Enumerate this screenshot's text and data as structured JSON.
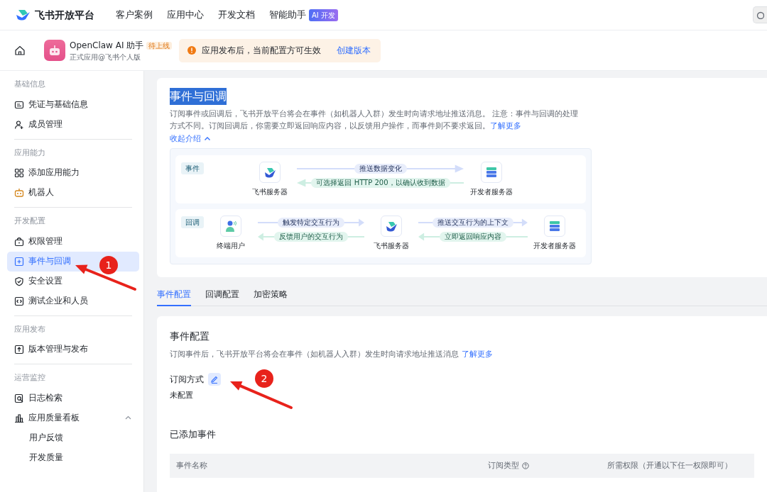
{
  "top_nav": {
    "brand": "飞书开放平台",
    "links": [
      {
        "label": "客户案例"
      },
      {
        "label": "应用中心"
      },
      {
        "label": "开发文档"
      },
      {
        "label": "智能助手",
        "badge": "AI 开发"
      }
    ]
  },
  "app_header": {
    "app_name": "OpenClaw AI 助手",
    "status_tag": "待上线",
    "subtitle": "正式应用@飞书个人版",
    "notice": "应用发布后，当前配置方可生效",
    "notice_action": "创建版本"
  },
  "sidebar": {
    "groups": [
      {
        "title": "基础信息",
        "items": [
          {
            "label": "凭证与基础信息",
            "selected": false
          },
          {
            "label": "成员管理",
            "selected": false
          }
        ]
      },
      {
        "title": "应用能力",
        "items": [
          {
            "label": "添加应用能力",
            "selected": false
          },
          {
            "label": "机器人",
            "selected": false
          }
        ]
      },
      {
        "title": "开发配置",
        "items": [
          {
            "label": "权限管理",
            "selected": false
          },
          {
            "label": "事件与回调",
            "selected": true
          },
          {
            "label": "安全设置",
            "selected": false
          },
          {
            "label": "测试企业和人员",
            "selected": false
          }
        ]
      },
      {
        "title": "应用发布",
        "items": [
          {
            "label": "版本管理与发布",
            "selected": false
          }
        ]
      },
      {
        "title": "运营监控",
        "items": [
          {
            "label": "日志检索",
            "selected": false
          },
          {
            "label": "应用质量看板",
            "selected": false,
            "expanded": true,
            "children": [
              {
                "label": "用户反馈",
                "selected": false
              },
              {
                "label": "开发质量",
                "selected": false
              }
            ]
          }
        ]
      }
    ]
  },
  "intro": {
    "title": "事件与回调",
    "highlighted": true,
    "description": "订阅事件或回调后，飞书开放平台将会在事件（如机器人入群）发生时向请求地址推送消息。 注意：事件与回调的处理方式不同。订阅回调后，你需要立即返回响应内容，以反馈用户操作，而事件则不要求返回。",
    "link": "了解更多",
    "toggle": "收起介绍",
    "expanded": true
  },
  "diagram": {
    "rows": [
      {
        "tag": "事件",
        "nodes": [
          {
            "kind": "platform",
            "label": "飞书服务器"
          },
          {
            "kind": "server",
            "label": "开发者服务器"
          }
        ],
        "links": [
          {
            "forward": "推送数据变化",
            "back": "可选择返回 HTTP 200，以确认收到数据"
          }
        ]
      },
      {
        "tag": "回调",
        "nodes": [
          {
            "kind": "user",
            "label": "终端用户"
          },
          {
            "kind": "platform",
            "label": "飞书服务器"
          },
          {
            "kind": "server",
            "label": "开发者服务器"
          }
        ],
        "links": [
          {
            "forward": "触发特定交互行为",
            "back": "反馈用户的交互行为"
          },
          {
            "forward": "推送交互行为的上下文",
            "back": "立即返回响应内容"
          }
        ]
      }
    ]
  },
  "tabs": [
    {
      "label": "事件配置",
      "selected": true
    },
    {
      "label": "回调配置",
      "selected": false
    },
    {
      "label": "加密策略",
      "selected": false
    }
  ],
  "event_config": {
    "title": "事件配置",
    "description": "订阅事件后，飞书开放平台将会在事件（如机器人入群）发生时向请求地址推送消息",
    "link": "了解更多",
    "subscription_label": "订阅方式",
    "subscription_value": "未配置",
    "added_title": "已添加事件",
    "table": {
      "columns": [
        {
          "label": "事件名称",
          "help": false
        },
        {
          "label": "订阅类型",
          "help": true
        },
        {
          "label": "所需权限（开通以下任一权限即可）",
          "help": false
        }
      ]
    }
  },
  "annotations": [
    {
      "label": "1"
    },
    {
      "label": "2"
    }
  ]
}
